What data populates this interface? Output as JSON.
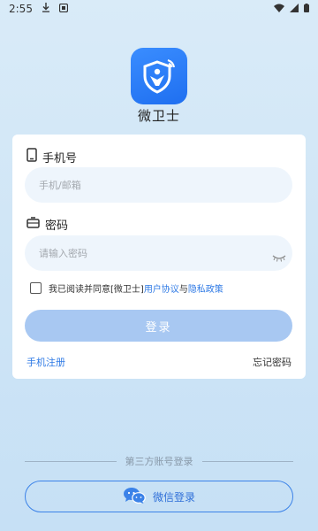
{
  "status_bar": {
    "time": "2:55"
  },
  "app": {
    "name": "微卫士"
  },
  "form": {
    "phone_label": "手机号",
    "phone_placeholder": "手机/邮箱",
    "password_label": "密码",
    "password_placeholder": "请输入密码",
    "agreement_prefix": "我已阅读并同意[微卫士]",
    "agreement_terms": "用户协议",
    "agreement_and": "与",
    "agreement_privacy": "隐私政策",
    "login_label": "登录",
    "register_link": "手机注册",
    "forgot_link": "忘记密码"
  },
  "third_party": {
    "divider_text": "第三方账号登录",
    "wechat_label": "微信登录"
  },
  "colors": {
    "accent": "#2f7ae5",
    "login_disabled": "#a8c8f2"
  }
}
